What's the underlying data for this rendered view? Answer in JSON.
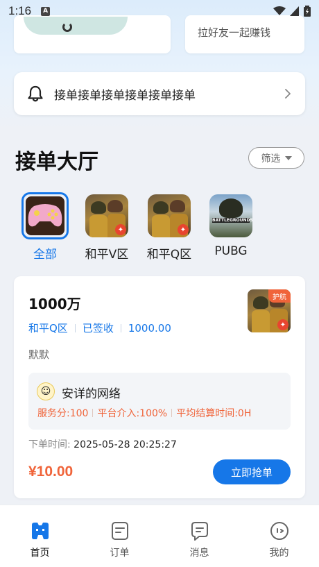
{
  "status_bar": {
    "time": "1:16"
  },
  "promo": {
    "right_text": "拉好友一起赚钱"
  },
  "notice": {
    "text": "接单接单接单接单接单接单"
  },
  "hall": {
    "title": "接单大厅",
    "filter_label": "筛选"
  },
  "categories": [
    {
      "label": "全部",
      "active": true
    },
    {
      "label": "和平V区",
      "active": false
    },
    {
      "label": "和平Q区",
      "active": false
    },
    {
      "label": "PUBG",
      "active": false
    }
  ],
  "order": {
    "title": "1000万",
    "badge": "护航",
    "tags": [
      "和平Q区",
      "已签收",
      "1000.00"
    ],
    "nickname": "默默",
    "user": {
      "name": "安详的网络",
      "stats": [
        "服务分:100",
        "平台介入:100%",
        "平均结算时间:0H"
      ]
    },
    "time_label": "下单时间:",
    "time_value": "2025-05-28 20:25:27",
    "price": "¥10.00",
    "grab_label": "立即抢单"
  },
  "tabbar": [
    {
      "label": "首页",
      "icon": "home-icon",
      "active": true
    },
    {
      "label": "订单",
      "icon": "order-icon",
      "active": false
    },
    {
      "label": "消息",
      "icon": "message-icon",
      "active": false
    },
    {
      "label": "我的",
      "icon": "profile-icon",
      "active": false
    }
  ],
  "colors": {
    "accent": "#1677e8",
    "price": "#f0643a"
  }
}
